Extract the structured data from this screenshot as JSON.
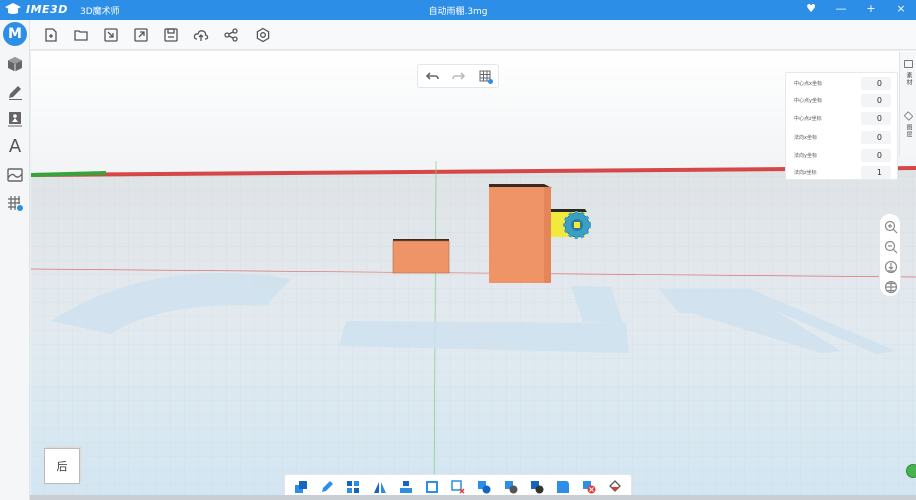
{
  "titlebar": {
    "brand": "IME3D",
    "subtitle": "3D魔术师",
    "file_name": "自动雨棚.3mg",
    "controls": [
      "♥",
      "—",
      "+",
      "×"
    ]
  },
  "toolbar": {
    "icons": [
      "new-file-icon",
      "open-folder-icon",
      "import-icon",
      "export-icon",
      "save-icon",
      "cloud-upload-icon",
      "share-icon",
      "settings-icon"
    ]
  },
  "sidebar": {
    "logo": "M",
    "items": [
      "cube-icon",
      "pen-icon",
      "image-icon",
      "text-icon",
      "landscape-icon",
      "grid-icon"
    ],
    "text_item": "A"
  },
  "properties": {
    "rows": [
      {
        "label": "中心点x坐标",
        "value": "0"
      },
      {
        "label": "中心点y坐标",
        "value": "0"
      },
      {
        "label": "中心点z坐标",
        "value": "0"
      },
      {
        "label": "法向x坐标",
        "value": "0"
      },
      {
        "label": "法向y坐标",
        "value": "0"
      },
      {
        "label": "法向z坐标",
        "value": "1"
      }
    ]
  },
  "right_tabs": [
    {
      "label": "素材"
    },
    {
      "label": "图层"
    }
  ],
  "view_cube": {
    "label": "后"
  },
  "colors": {
    "accent": "#2c8ee6",
    "box": "#ef9466",
    "box_top": "#3a2a22",
    "accessory": "#f1ea3c",
    "gear": "#3a9fc4"
  }
}
